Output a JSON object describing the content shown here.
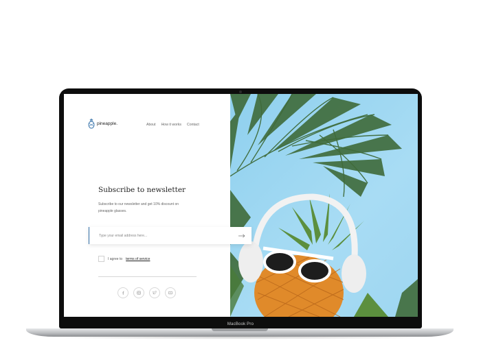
{
  "device": {
    "label": "MacBook Pro"
  },
  "site": {
    "logo_text": "pineapple.",
    "nav": [
      {
        "label": "About"
      },
      {
        "label": "How it works"
      },
      {
        "label": "Contact"
      }
    ],
    "title": "Subscribe to newsletter",
    "subtitle": "Subscribe to our newsletter and get 10% discount on pineapple glasses.",
    "email": {
      "placeholder": "Type your email address here...",
      "value": ""
    },
    "submit_icon": "arrow-right-icon",
    "terms": {
      "prefix": "I agree to",
      "link": "terms of service"
    },
    "socials": [
      "facebook-icon",
      "instagram-icon",
      "twitter-icon",
      "youtube-icon"
    ]
  },
  "colors": {
    "accent": "#2f6da6",
    "sky": "#a8dcf4",
    "leaf": "#3f6b3a",
    "pineapple": "#e08a2a"
  }
}
